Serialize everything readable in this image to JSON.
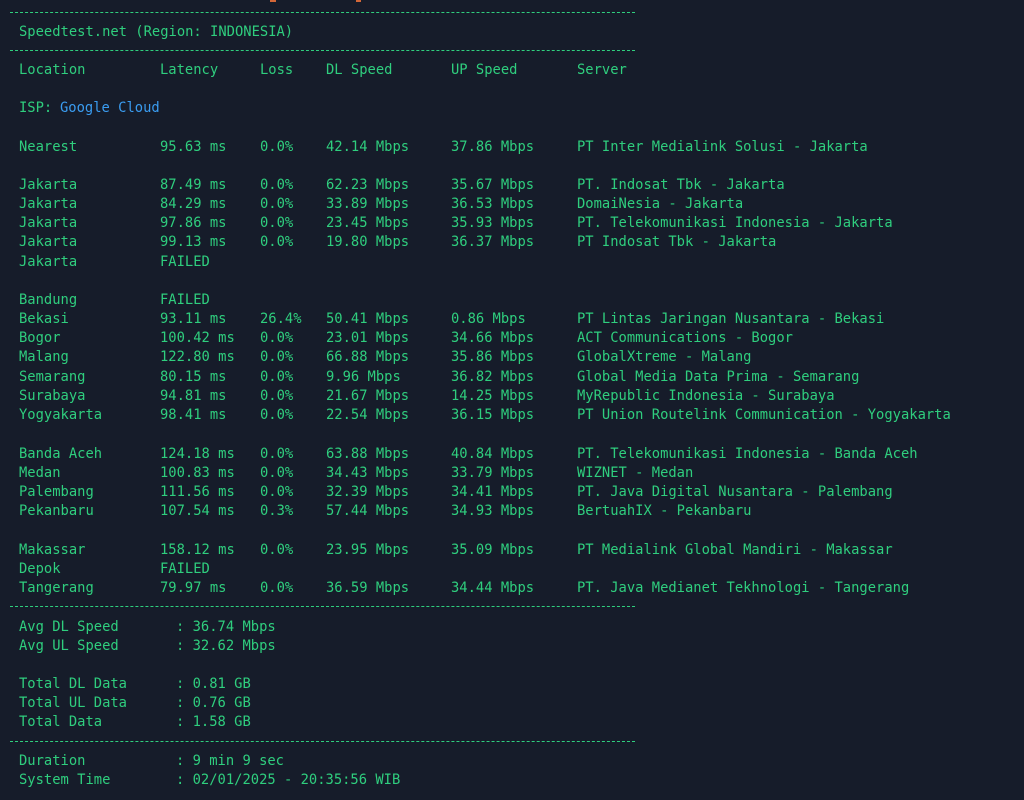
{
  "title": "Speedtest.net (Region: INDONESIA)",
  "columns": {
    "location": "Location",
    "latency": "Latency",
    "loss": "Loss",
    "dl": "DL Speed",
    "ul": "UP Speed",
    "server": "Server"
  },
  "isp": {
    "label": "ISP:",
    "value": "Google Cloud"
  },
  "results": [
    {
      "location": "Nearest",
      "latency": "95.63 ms",
      "loss": "0.0%",
      "dl": "42.14 Mbps",
      "ul": "37.86 Mbps",
      "server": "PT Inter Medialink Solusi - Jakarta"
    },
    {
      "location": "Jakarta",
      "latency": "87.49 ms",
      "loss": "0.0%",
      "dl": "62.23 Mbps",
      "ul": "35.67 Mbps",
      "server": "PT. Indosat Tbk - Jakarta"
    },
    {
      "location": "Jakarta",
      "latency": "84.29 ms",
      "loss": "0.0%",
      "dl": "33.89 Mbps",
      "ul": "36.53 Mbps",
      "server": "DomaiNesia - Jakarta"
    },
    {
      "location": "Jakarta",
      "latency": "97.86 ms",
      "loss": "0.0%",
      "dl": "23.45 Mbps",
      "ul": "35.93 Mbps",
      "server": "PT. Telekomunikasi Indonesia - Jakarta"
    },
    {
      "location": "Jakarta",
      "latency": "99.13 ms",
      "loss": "0.0%",
      "dl": "19.80 Mbps",
      "ul": "36.37 Mbps",
      "server": "PT Indosat Tbk - Jakarta"
    },
    {
      "location": "Jakarta",
      "latency": "FAILED",
      "loss": "",
      "dl": "",
      "ul": "",
      "server": ""
    },
    {
      "location": "Bandung",
      "latency": "FAILED",
      "loss": "",
      "dl": "",
      "ul": "",
      "server": ""
    },
    {
      "location": "Bekasi",
      "latency": "93.11 ms",
      "loss": "26.4%",
      "dl": "50.41 Mbps",
      "ul": "0.86 Mbps",
      "server": "PT Lintas Jaringan Nusantara - Bekasi"
    },
    {
      "location": "Bogor",
      "latency": "100.42 ms",
      "loss": "0.0%",
      "dl": "23.01 Mbps",
      "ul": "34.66 Mbps",
      "server": "ACT Communications - Bogor"
    },
    {
      "location": "Malang",
      "latency": "122.80 ms",
      "loss": "0.0%",
      "dl": "66.88 Mbps",
      "ul": "35.86 Mbps",
      "server": "GlobalXtreme - Malang"
    },
    {
      "location": "Semarang",
      "latency": "80.15 ms",
      "loss": "0.0%",
      "dl": "9.96 Mbps",
      "ul": "36.82 Mbps",
      "server": "Global Media Data Prima - Semarang"
    },
    {
      "location": "Surabaya",
      "latency": "94.81 ms",
      "loss": "0.0%",
      "dl": "21.67 Mbps",
      "ul": "14.25 Mbps",
      "server": "MyRepublic Indonesia - Surabaya"
    },
    {
      "location": "Yogyakarta",
      "latency": "98.41 ms",
      "loss": "0.0%",
      "dl": "22.54 Mbps",
      "ul": "36.15 Mbps",
      "server": "PT Union Routelink Communication - Yogyakarta"
    },
    {
      "location": "Banda Aceh",
      "latency": "124.18 ms",
      "loss": "0.0%",
      "dl": "63.88 Mbps",
      "ul": "40.84 Mbps",
      "server": "PT. Telekomunikasi Indonesia - Banda Aceh"
    },
    {
      "location": "Medan",
      "latency": "100.83 ms",
      "loss": "0.0%",
      "dl": "34.43 Mbps",
      "ul": "33.79 Mbps",
      "server": "WIZNET - Medan"
    },
    {
      "location": "Palembang",
      "latency": "111.56 ms",
      "loss": "0.0%",
      "dl": "32.39 Mbps",
      "ul": "34.41 Mbps",
      "server": "PT. Java Digital Nusantara - Palembang"
    },
    {
      "location": "Pekanbaru",
      "latency": "107.54 ms",
      "loss": "0.3%",
      "dl": "57.44 Mbps",
      "ul": "34.93 Mbps",
      "server": "BertuahIX - Pekanbaru"
    },
    {
      "location": "Makassar",
      "latency": "158.12 ms",
      "loss": "0.0%",
      "dl": "23.95 Mbps",
      "ul": "35.09 Mbps",
      "server": "PT Medialink Global Mandiri - Makassar"
    },
    {
      "location": "Depok",
      "latency": "FAILED",
      "loss": "",
      "dl": "",
      "ul": "",
      "server": ""
    },
    {
      "location": "Tangerang",
      "latency": "79.97 ms",
      "loss": "0.0%",
      "dl": "36.59 Mbps",
      "ul": "34.44 Mbps",
      "server": "PT. Java Medianet Tekhnologi - Tangerang"
    }
  ],
  "summary": [
    {
      "label": "Avg DL Speed",
      "value": ": 36.74 Mbps"
    },
    {
      "label": "Avg UL Speed",
      "value": ": 32.62 Mbps"
    },
    {
      "label": "Total DL Data",
      "value": ": 0.81 GB"
    },
    {
      "label": "Total UL Data",
      "value": ": 0.76 GB"
    },
    {
      "label": "Total Data",
      "value": ": 1.58 GB"
    }
  ],
  "footer": [
    {
      "label": "Duration",
      "value": ": 9 min 9 sec"
    },
    {
      "label": "System Time",
      "value": ": 02/01/2025 - 20:35:56 WIB"
    }
  ],
  "colors": {
    "background": "#161c2a",
    "text": "#2fce7e",
    "isp_value": "#3a9cf0"
  }
}
